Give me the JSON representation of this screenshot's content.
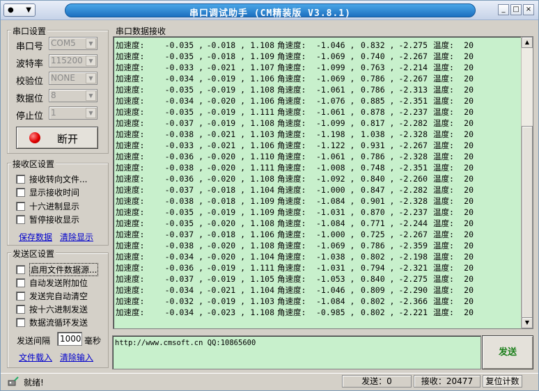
{
  "window": {
    "sys_menu_glyph": "●",
    "sys_menu_arrow": "▼",
    "title": "串口调试助手 (CM精装版 V3.8.1)",
    "minimize": "_",
    "restore": "□",
    "close": "×"
  },
  "serial": {
    "group_title": "串口设置",
    "port_label": "串口号",
    "port_value": "COM5",
    "baud_label": "波特率",
    "baud_value": "115200",
    "parity_label": "校验位",
    "parity_value": "NONE",
    "databits_label": "数据位",
    "databits_value": "8",
    "stopbits_label": "停止位",
    "stopbits_value": "1",
    "connect_button": "断开",
    "dropdown_arrow": "▼"
  },
  "receive_settings": {
    "group_title": "接收区设置",
    "options": [
      "接收转向文件...",
      "显示接收时间",
      "十六进制显示",
      "暂停接收显示"
    ],
    "save_link": "保存数据",
    "clear_link": "清除显示"
  },
  "send_settings": {
    "group_title": "发送区设置",
    "options": [
      "启用文件数据源...",
      "自动发送附加位",
      "发送完自动清空",
      "按十六进制发送",
      "数据流循环发送"
    ],
    "interval_label": "发送间隔",
    "interval_value": "1000",
    "interval_unit": "毫秒",
    "load_file_link": "文件载入",
    "clear_input_link": "清除输入"
  },
  "receive_area": {
    "group_title": "串口数据接收",
    "accel_label": "加速度:",
    "gyro_label": "角速度:",
    "temp_label": "温度:",
    "scroll_up": "▲",
    "scroll_down": "▼",
    "rows": [
      [
        "-0.035 ,",
        "-0.018 ,",
        "1.108",
        "-1.046 ,",
        "0.832 ,",
        "-2.275",
        "20"
      ],
      [
        "-0.035 ,",
        "-0.018 ,",
        "1.109",
        "-1.069 ,",
        "0.740 ,",
        "-2.267",
        "20"
      ],
      [
        "-0.033 ,",
        "-0.021 ,",
        "1.107",
        "-1.099 ,",
        "0.763 ,",
        "-2.214",
        "20"
      ],
      [
        "-0.034 ,",
        "-0.019 ,",
        "1.106",
        "-1.069 ,",
        "0.786 ,",
        "-2.267",
        "20"
      ],
      [
        "-0.035 ,",
        "-0.019 ,",
        "1.108",
        "-1.061 ,",
        "0.786 ,",
        "-2.313",
        "20"
      ],
      [
        "-0.034 ,",
        "-0.020 ,",
        "1.106",
        "-1.076 ,",
        "0.885 ,",
        "-2.351",
        "20"
      ],
      [
        "-0.035 ,",
        "-0.019 ,",
        "1.111",
        "-1.061 ,",
        "0.878 ,",
        "-2.237",
        "20"
      ],
      [
        "-0.037 ,",
        "-0.019 ,",
        "1.108",
        "-1.099 ,",
        "0.817 ,",
        "-2.282",
        "20"
      ],
      [
        "-0.038 ,",
        "-0.021 ,",
        "1.103",
        "-1.198 ,",
        "1.038 ,",
        "-2.328",
        "20"
      ],
      [
        "-0.033 ,",
        "-0.021 ,",
        "1.106",
        "-1.122 ,",
        "0.931 ,",
        "-2.267",
        "20"
      ],
      [
        "-0.036 ,",
        "-0.020 ,",
        "1.110",
        "-1.061 ,",
        "0.786 ,",
        "-2.328",
        "20"
      ],
      [
        "-0.038 ,",
        "-0.020 ,",
        "1.111",
        "-1.008 ,",
        "0.748 ,",
        "-2.351",
        "20"
      ],
      [
        "-0.036 ,",
        "-0.020 ,",
        "1.108",
        "-1.092 ,",
        "0.840 ,",
        "-2.260",
        "20"
      ],
      [
        "-0.037 ,",
        "-0.018 ,",
        "1.104",
        "-1.000 ,",
        "0.847 ,",
        "-2.282",
        "20"
      ],
      [
        "-0.038 ,",
        "-0.018 ,",
        "1.109",
        "-1.084 ,",
        "0.901 ,",
        "-2.328",
        "20"
      ],
      [
        "-0.035 ,",
        "-0.019 ,",
        "1.109",
        "-1.031 ,",
        "0.870 ,",
        "-2.237",
        "20"
      ],
      [
        "-0.035 ,",
        "-0.020 ,",
        "1.108",
        "-1.084 ,",
        "0.771 ,",
        "-2.244",
        "20"
      ],
      [
        "-0.037 ,",
        "-0.018 ,",
        "1.106",
        "-1.000 ,",
        "0.725 ,",
        "-2.267",
        "20"
      ],
      [
        "-0.038 ,",
        "-0.020 ,",
        "1.108",
        "-1.069 ,",
        "0.786 ,",
        "-2.359",
        "20"
      ],
      [
        "-0.034 ,",
        "-0.020 ,",
        "1.104",
        "-1.038 ,",
        "0.802 ,",
        "-2.198",
        "20"
      ],
      [
        "-0.036 ,",
        "-0.019 ,",
        "1.111",
        "-1.031 ,",
        "0.794 ,",
        "-2.321",
        "20"
      ],
      [
        "-0.037 ,",
        "-0.019 ,",
        "1.105",
        "-1.053 ,",
        "0.840 ,",
        "-2.275",
        "20"
      ],
      [
        "-0.034 ,",
        "-0.021 ,",
        "1.104",
        "-1.046 ,",
        "0.809 ,",
        "-2.290",
        "20"
      ],
      [
        "-0.032 ,",
        "-0.019 ,",
        "1.103",
        "-1.084 ,",
        "0.802 ,",
        "-2.366",
        "20"
      ],
      [
        "-0.034 ,",
        "-0.023 ,",
        "1.108",
        "-0.985 ,",
        "0.802 ,",
        "-2.221",
        "20"
      ]
    ]
  },
  "send_area": {
    "input_value": "http://www.cmsoft.cn QQ:10865600",
    "send_button": "发送"
  },
  "status": {
    "ready_text": "就绪!",
    "sent_text": "发送：0",
    "received_text": "接收：20477",
    "reset_button": "复位计数"
  }
}
